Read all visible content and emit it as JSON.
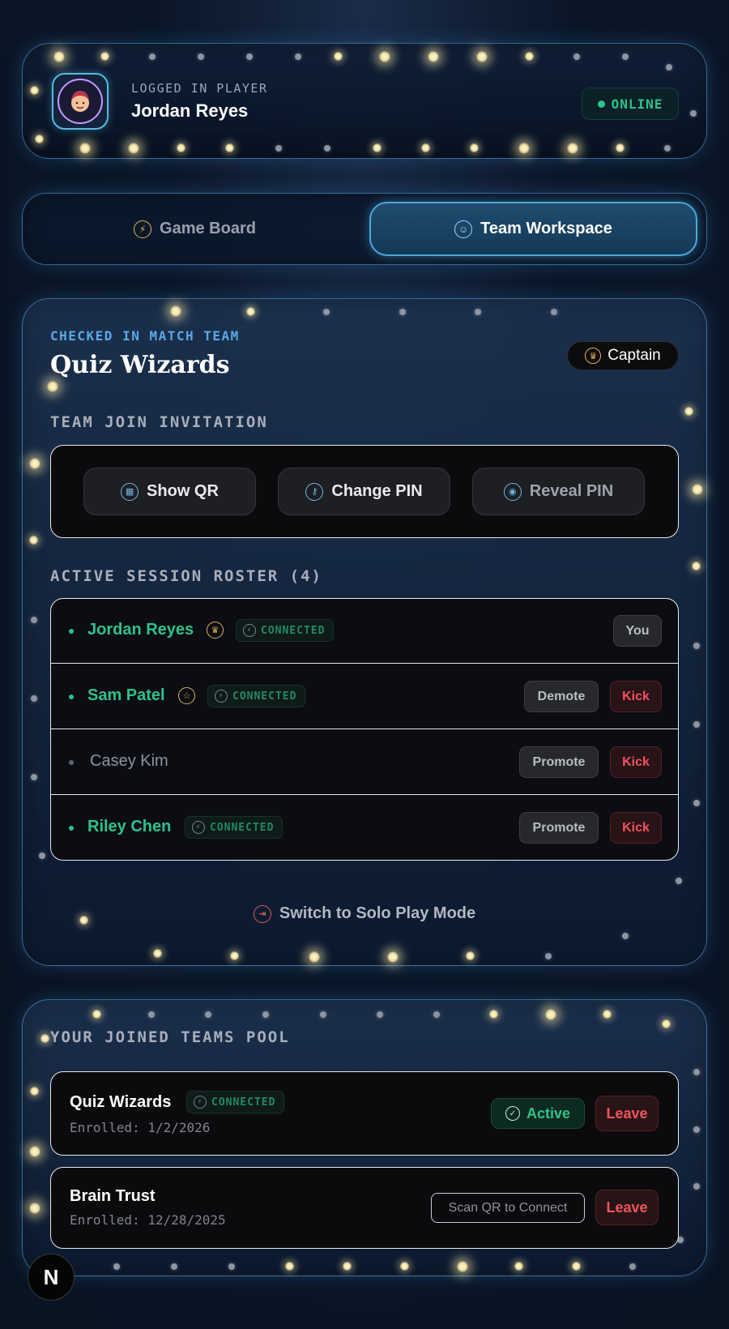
{
  "player": {
    "label": "LOGGED IN PLAYER",
    "name": "Jordan Reyes",
    "status": "ONLINE",
    "avatar_icon": "player-face-icon"
  },
  "tabs": [
    {
      "label": "Game Board",
      "icon": "bolt-icon",
      "active": false
    },
    {
      "label": "Team Workspace",
      "icon": "team-icon",
      "active": true
    }
  ],
  "team": {
    "kicker": "CHECKED IN MATCH TEAM",
    "name": "Quiz Wizards",
    "role_badge": "Captain",
    "invite_title": "TEAM JOIN INVITATION",
    "invite_buttons": [
      {
        "label": "Show QR",
        "icon": "qr-icon"
      },
      {
        "label": "Change PIN",
        "icon": "key-icon"
      },
      {
        "label": "Reveal PIN",
        "icon": "eye-icon"
      }
    ],
    "roster_title": "ACTIVE SESSION ROSTER (4)",
    "roster": [
      {
        "name": "Jordan Reyes",
        "role_icon": "crown-icon",
        "status": "CONNECTED",
        "actions": [
          "You"
        ]
      },
      {
        "name": "Sam Patel",
        "role_icon": "star-icon",
        "status": "CONNECTED",
        "actions": [
          "Demote",
          "Kick"
        ]
      },
      {
        "name": "Casey Kim",
        "role_icon": "",
        "status": "",
        "actions": [
          "Promote",
          "Kick"
        ]
      },
      {
        "name": "Riley Chen",
        "role_icon": "",
        "status": "CONNECTED",
        "actions": [
          "Promote",
          "Kick"
        ]
      }
    ],
    "solo_link": "Switch to Solo Play Mode"
  },
  "pool": {
    "title": "YOUR JOINED TEAMS POOL",
    "items": [
      {
        "name": "Quiz Wizards",
        "status": "CONNECTED",
        "enrolled": "Enrolled: 1/2/2026",
        "state": "Active",
        "leave": "Leave"
      },
      {
        "name": "Brain Trust",
        "enrolled": "Enrolled: 12/28/2025",
        "scan": "Scan QR to Connect",
        "leave": "Leave"
      }
    ]
  },
  "logo": "N",
  "colors": {
    "accent_blue": "#4aa8da",
    "connected_green": "#2ec28b",
    "kick_red": "#f2545d",
    "gold": "#e3b059"
  }
}
